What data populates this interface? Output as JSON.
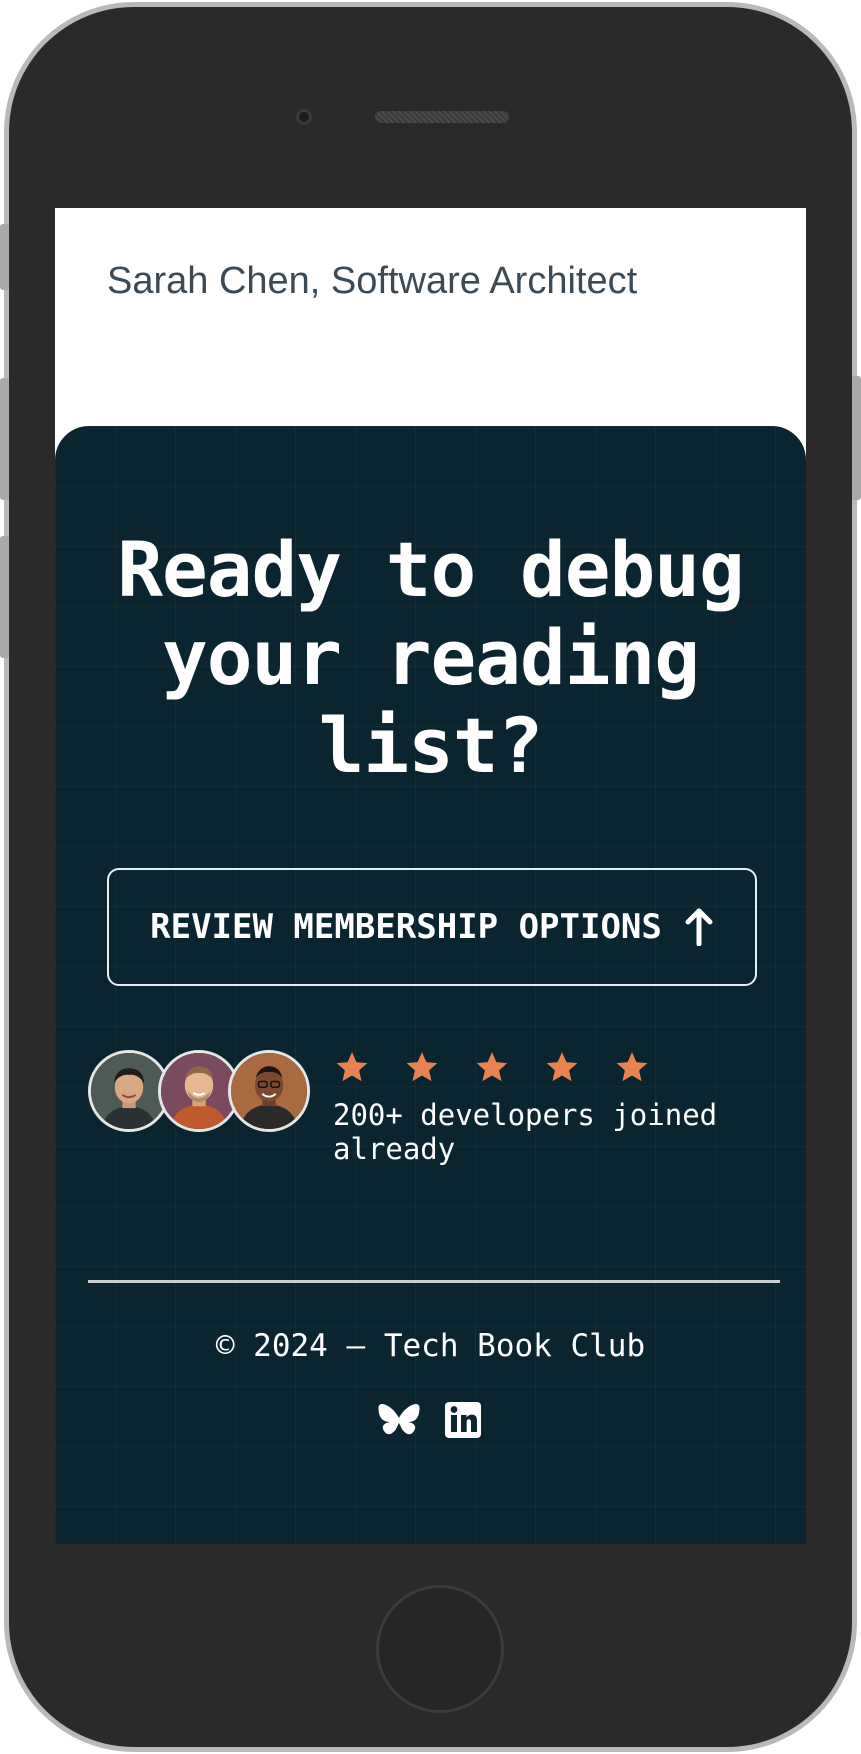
{
  "header": {
    "name": "Sarah Chen, Software Architect"
  },
  "cta": {
    "headline": "Ready to debug your reading list?",
    "button_label": "REVIEW MEMBERSHIP OPTIONS",
    "button_icon": "arrow-up-icon"
  },
  "social_proof": {
    "rating": 5,
    "rating_max": 5,
    "text": "200+ developers joined already",
    "avatars": [
      "avatar-1",
      "avatar-2",
      "avatar-3"
    ]
  },
  "footer": {
    "copyright": "© 2024 – Tech Book Club",
    "icons": [
      "bluesky-icon",
      "linkedin-icon"
    ]
  },
  "colors": {
    "cta_background": "#0a2530",
    "star": "#e8834f",
    "text_light": "#ffffff",
    "header_text": "#3b4a55"
  }
}
